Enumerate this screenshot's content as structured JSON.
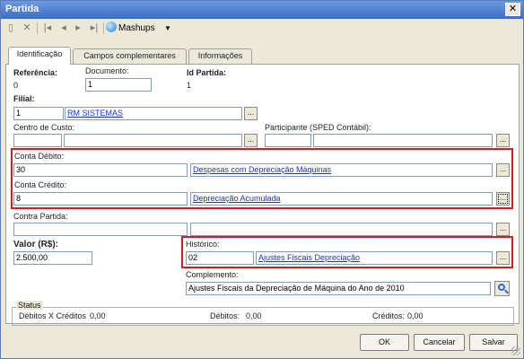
{
  "window": {
    "title": "Partida",
    "close_glyph": "✕"
  },
  "toolbar": {
    "icons": [
      "new-icon",
      "delete-icon",
      "first-record-icon",
      "prev-record-icon",
      "next-record-icon",
      "last-record-icon"
    ],
    "mashups_label": "Mashups"
  },
  "tabs": [
    "Identificação",
    "Campos complementares",
    "Informações"
  ],
  "form": {
    "referencia": {
      "label": "Referência:",
      "value": "0"
    },
    "documento": {
      "label": "Documento:",
      "value": "1"
    },
    "id_partida": {
      "label": "Id Partida:",
      "value": "1"
    },
    "filial": {
      "label": "Filial:",
      "code": "1",
      "name": "RM SISTEMAS"
    },
    "centro_custo": {
      "label": "Centro de Custo:",
      "code": "",
      "name": ""
    },
    "participante": {
      "label": "Participante (SPED Contábil):",
      "code": "",
      "name": ""
    },
    "conta_debito": {
      "label": "Conta Débito:",
      "code": "30",
      "name": "Despesas com Depreciação Máquinas"
    },
    "conta_credito": {
      "label": "Conta Crédito:",
      "code": "8",
      "name": "Depreciação Acumulada"
    },
    "contra_partida": {
      "label": "Contra Partida:",
      "code": "",
      "name": ""
    },
    "valor": {
      "label": "Valor (R$):",
      "value": "2.500,00"
    },
    "historico": {
      "label": "Histórico:",
      "code": "02",
      "name": "Ajustes Fiscais Depreciação"
    },
    "complemento": {
      "label": "Complemento:",
      "value": "Ajustes Fiscais da Depreciação de Máquina do Ano de 2010"
    },
    "lookup_glyph": "..."
  },
  "status": {
    "title": "Status",
    "diff_label": "Débitos X Créditos",
    "diff_value": "0,00",
    "debitos_label": "Débitos:",
    "debitos_value": "0,00",
    "creditos_label": "Créditos:",
    "creditos_value": "0,00"
  },
  "buttons": {
    "ok": "OK",
    "cancel": "Cancelar",
    "save": "Salvar"
  },
  "colors": {
    "highlight_border": "#d41c1c",
    "titlebar": "#3a6cc4",
    "link": "#1a33cc"
  }
}
